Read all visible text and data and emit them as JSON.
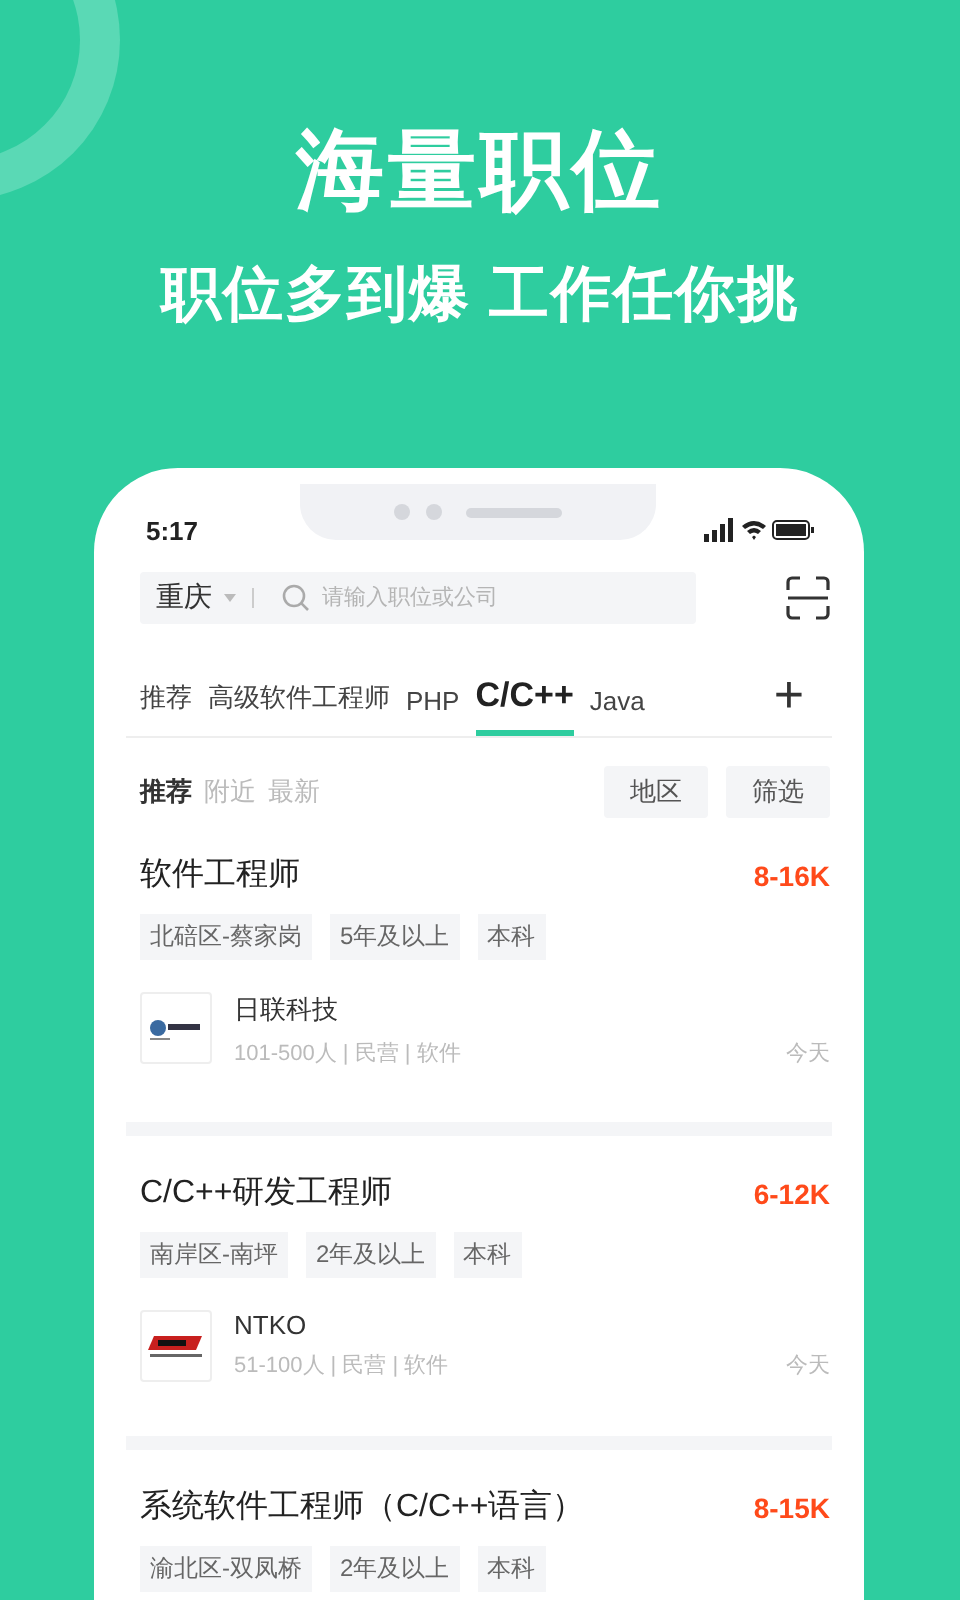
{
  "promo": {
    "title": "海量职位",
    "subtitle": "职位多到爆 工作任你挑"
  },
  "status_bar": {
    "time": "5:17"
  },
  "search": {
    "city": "重庆",
    "placeholder": "请输入职位或公司"
  },
  "tabs": [
    {
      "label": "推荐",
      "selected": false
    },
    {
      "label": "高级软件工程师",
      "selected": false
    },
    {
      "label": "PHP",
      "selected": false
    },
    {
      "label": "C/C++",
      "selected": true
    },
    {
      "label": "Java",
      "selected": false
    }
  ],
  "add_tab": "+",
  "feed_tabs": [
    {
      "label": "推荐",
      "selected": true
    },
    {
      "label": "附近",
      "selected": false
    },
    {
      "label": "最新",
      "selected": false
    }
  ],
  "filters": [
    "地区",
    "筛选"
  ],
  "jobs": [
    {
      "title": "软件工程师",
      "salary": "8-16K",
      "tags": [
        "北碚区-蔡家岗",
        "5年及以上",
        "本科"
      ],
      "company": "日联科技",
      "company_info": "101-500人 | 民营 | 软件",
      "posted": "今天"
    },
    {
      "title": "C/C++研发工程师",
      "salary": "6-12K",
      "tags": [
        "南岸区-南坪",
        "2年及以上",
        "本科"
      ],
      "company": "NTKO",
      "company_info": "51-100人 | 民营 | 软件",
      "posted": "今天"
    },
    {
      "title": "系统软件工程师（C/C++语言）",
      "salary": "8-15K",
      "tags": [
        "渝北区-双凤桥",
        "2年及以上",
        "本科"
      ]
    }
  ]
}
